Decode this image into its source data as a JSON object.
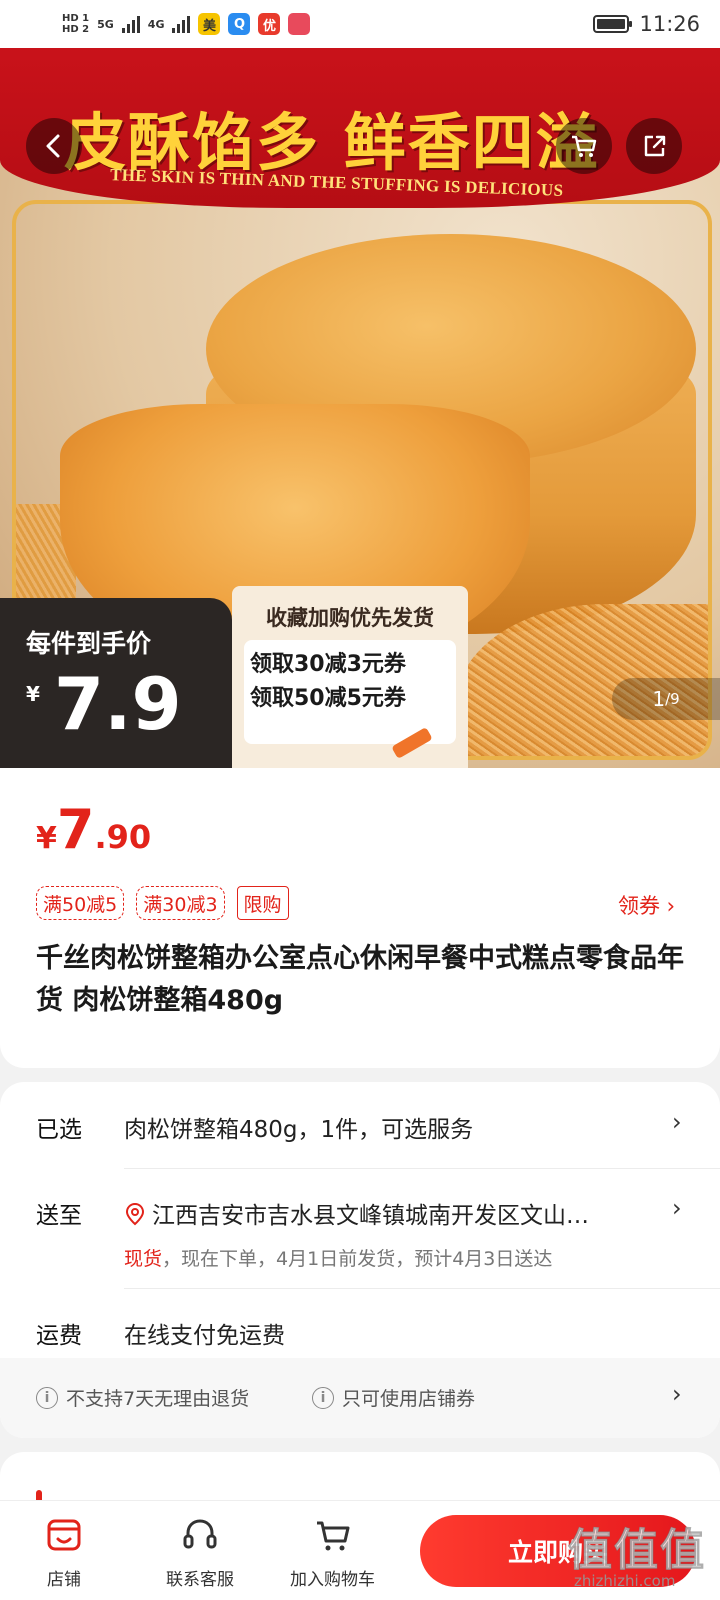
{
  "status": {
    "sim1": "HD 1",
    "sim2": "HD 2",
    "net1": "5G",
    "net2": "4G",
    "apps": [
      "美",
      "Q",
      "优",
      ""
    ],
    "time": "11:26"
  },
  "hero": {
    "banner_title": "皮酥馅多 鲜香四溢",
    "banner_sub": "THE SKIN IS THIN AND THE STUFFING IS DELICIOUS",
    "badge_label": "每件到手价",
    "badge_currency": "¥",
    "badge_price": "7.9",
    "coupon_head": "收藏加购优先发货",
    "coupon_lines": [
      "领取30减3元券",
      "领取50减5元券"
    ],
    "pager_current": "1",
    "pager_total": "/9"
  },
  "product": {
    "currency": "¥",
    "price_int": "7",
    "price_dec": ".90",
    "tags": [
      "满50减5",
      "满30减3",
      "限购"
    ],
    "get_coupon": "领券 ›",
    "title": "千丝肉松饼整箱办公室点心休闲早餐中式糕点零食品年货 肉松饼整箱480g"
  },
  "details": {
    "selected_label": "已选",
    "selected_value": "肉松饼整箱480g，1件，可选服务",
    "ship_label": "送至",
    "ship_address": "江西吉安市吉水县文峰镇城南开发区文山…",
    "ship_stock": "现货",
    "ship_note": "，现在下单，4月1日前发货，预计4月3日送达",
    "fee_label": "运费",
    "fee_value": "在线支付免运费",
    "policy1": "不支持7天无理由退货",
    "policy2": "只可使用店铺券",
    "chevron": "›"
  },
  "bottom": {
    "store": "店铺",
    "service": "联系客服",
    "add_cart": "加入购物车",
    "buy_now": "立即购买"
  },
  "watermark": {
    "main": "值值值",
    "sub": "zhizhizhi.com"
  },
  "colors": {
    "accent": "#e2231a",
    "banner": "#c9121a",
    "banner_text": "#ffd23a"
  }
}
